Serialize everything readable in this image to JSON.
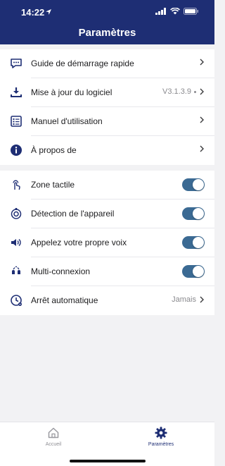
{
  "status_bar": {
    "time": "14:22"
  },
  "header": {
    "title": "Paramètres"
  },
  "menu_group": [
    {
      "label": "Guide de démarrage rapide",
      "value": "",
      "icon": "chat-guide-icon"
    },
    {
      "label": "Mise à jour du logiciel",
      "value": "V3.1.3.9",
      "icon": "download-icon"
    },
    {
      "label": "Manuel d'utilisation",
      "value": "",
      "icon": "manual-list-icon"
    },
    {
      "label": "À propos de",
      "value": "",
      "icon": "info-icon"
    }
  ],
  "settings_group": [
    {
      "label": "Zone tactile",
      "type": "toggle",
      "on": true,
      "icon": "touch-icon"
    },
    {
      "label": "Détection de l'appareil",
      "type": "toggle",
      "on": true,
      "icon": "wear-detection-icon"
    },
    {
      "label": "Appelez votre propre voix",
      "type": "toggle",
      "on": true,
      "icon": "speaker-voice-icon"
    },
    {
      "label": "Multi-connexion",
      "type": "toggle",
      "on": true,
      "icon": "multi-connection-icon"
    },
    {
      "label": "Arrêt automatique",
      "type": "value",
      "value": "Jamais",
      "icon": "auto-off-clock-icon"
    }
  ],
  "tabbar": {
    "home_label": "Accueil",
    "settings_label": "Paramètres"
  },
  "colors": {
    "header": "#1e2e74",
    "toggle_on": "#3b6a93",
    "icon": "#1e2e74"
  }
}
